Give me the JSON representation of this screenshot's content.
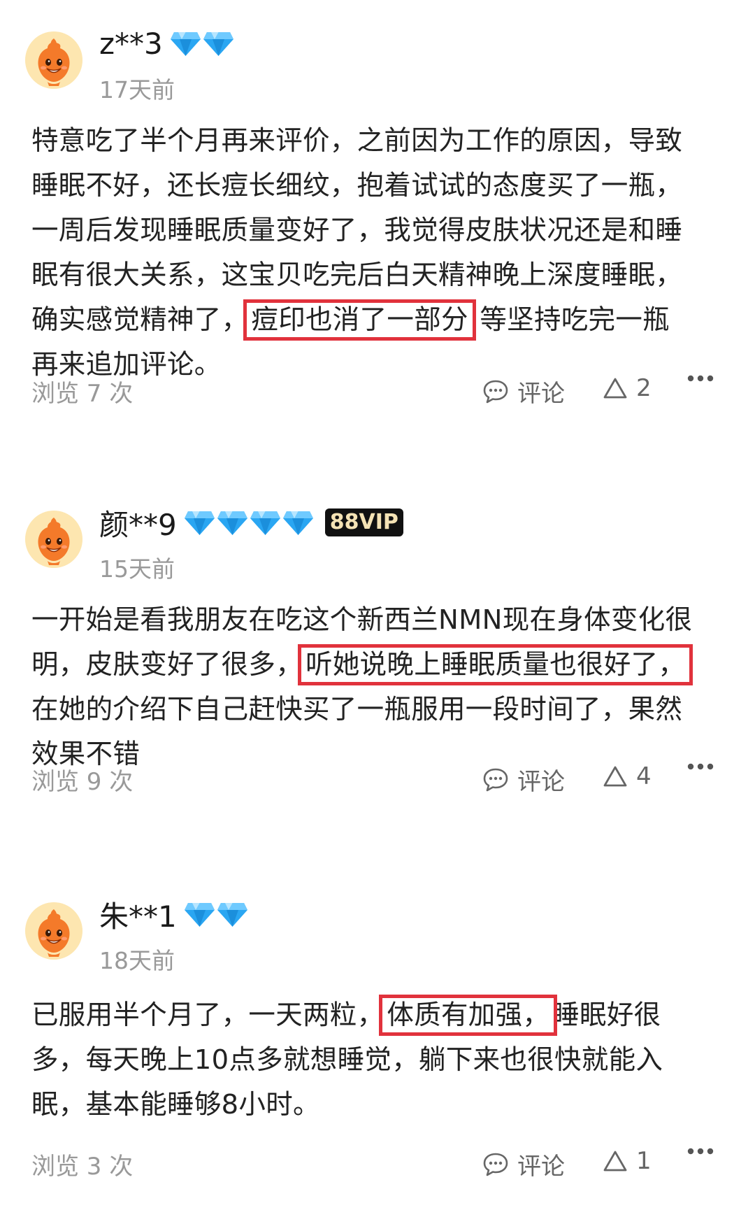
{
  "reviews": [
    {
      "username": "z**3",
      "diamonds": 2,
      "vip": "",
      "time": "17天前",
      "lines": [
        [
          {
            "t": " 特意吃了半个月再来评价，之前因为工作的原因，导致"
          }
        ],
        [
          {
            "t": "睡眠不好，还长痘长细纹，抱着试试的态度买了一瓶，"
          }
        ],
        [
          {
            "t": "一周后发现睡眠质量变好了，我觉得皮肤状况还是和睡"
          }
        ],
        [
          {
            "t": "眠有很大关系，这宝贝吃完后白天精神晚上深度睡眠，"
          }
        ],
        [
          {
            "t": "确实感觉精神了，"
          },
          {
            "t": "痘印也消了一部分",
            "hl": true
          },
          {
            "t": " 等坚持吃完一瓶"
          }
        ],
        [
          {
            "t": "再来追加评论。"
          }
        ]
      ],
      "views": "浏览 7 次",
      "comment_label": "评论",
      "likes": "2"
    },
    {
      "username": "颜**9",
      "diamonds": 4,
      "vip": "88VIP",
      "time": "15天前",
      "lines": [
        [
          {
            "t": "一开始是看我朋友在吃这个新西兰NMN现在身体变化很"
          }
        ],
        [
          {
            "t": "明，皮肤变好了很多，"
          },
          {
            "t": "听她说晚上睡眠质量也很好了，",
            "hl": true
          }
        ],
        [
          {
            "t": "在她的介绍下自己赶快买了一瓶服用一段时间了，果然"
          }
        ],
        [
          {
            "t": "效果不错"
          }
        ]
      ],
      "views": "浏览 9 次",
      "comment_label": "评论",
      "likes": "4"
    },
    {
      "username": "朱**1",
      "diamonds": 2,
      "vip": "",
      "time": "18天前",
      "lines": [
        [
          {
            "t": "已服用半个月了，一天两粒，"
          },
          {
            "t": "体质有加强，",
            "hl": true
          },
          {
            "t": "睡眠好很"
          }
        ],
        [
          {
            "t": "多，每天晚上10点多就想睡觉，躺下来也很快就能入"
          }
        ],
        [
          {
            "t": "眠，基本能睡够8小时。"
          }
        ]
      ],
      "views": "浏览 3 次",
      "comment_label": "评论",
      "likes": "1"
    }
  ],
  "icons": {
    "avatar": "taobao-mascot-icon",
    "level": "diamond-icon",
    "comment": "comment-bubble-icon",
    "like": "like-triangle-icon",
    "more": "more-dots-icon"
  },
  "colors": {
    "highlight_box": "#e1323c",
    "diamond": "#2aa6f2",
    "muted_text": "#999999"
  }
}
